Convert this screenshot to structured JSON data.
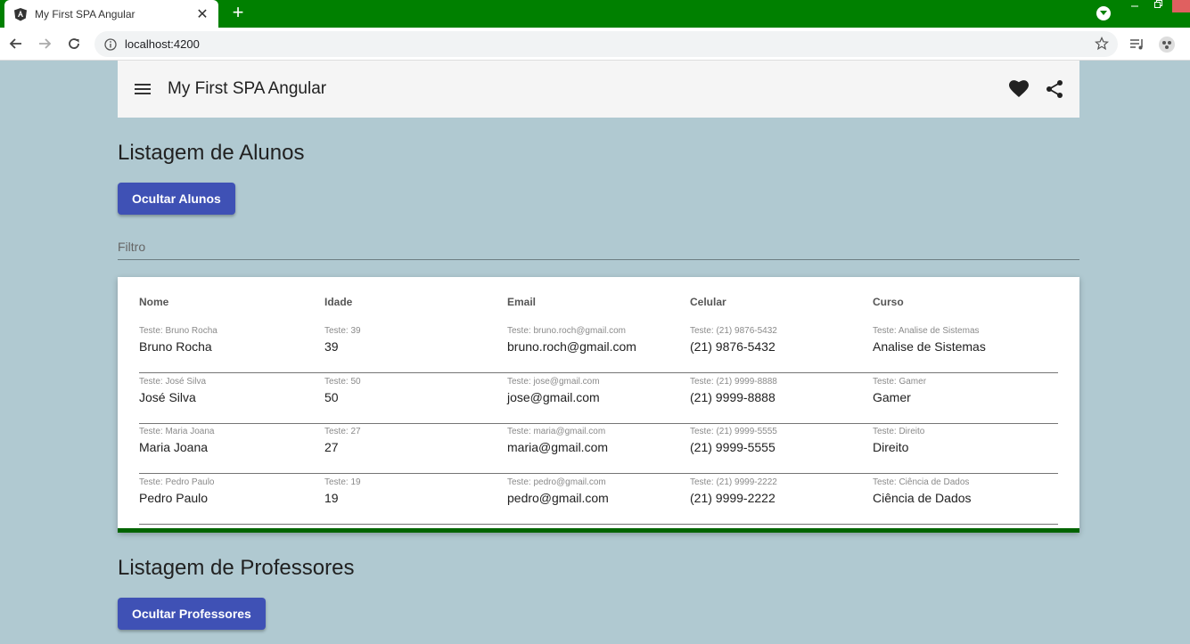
{
  "browser": {
    "tab_title": "My First SPA Angular",
    "tab_close": "✕",
    "new_tab": "+",
    "url": "localhost:4200"
  },
  "app": {
    "title": "My First SPA Angular",
    "icons": [
      "menu-icon",
      "heart-icon",
      "share-icon"
    ]
  },
  "alunos": {
    "title": "Listagem de Alunos",
    "button": "Ocultar Alunos",
    "filter_label": "Filtro",
    "headers": [
      "Nome",
      "Idade",
      "Email",
      "Celular",
      "Curso"
    ],
    "rows": [
      {
        "hints": [
          "Teste: Bruno Rocha",
          "Teste: 39",
          "Teste: bruno.roch@gmail.com",
          "Teste: (21) 9876-5432",
          "Teste: Analise de Sistemas"
        ],
        "values": [
          "Bruno Rocha",
          "39",
          "bruno.roch@gmail.com",
          "(21) 9876-5432",
          "Analise de Sistemas"
        ]
      },
      {
        "hints": [
          "Teste: José Silva",
          "Teste: 50",
          "Teste: jose@gmail.com",
          "Teste: (21) 9999-8888",
          "Teste: Gamer"
        ],
        "values": [
          "José Silva",
          "50",
          "jose@gmail.com",
          "(21) 9999-8888",
          "Gamer"
        ]
      },
      {
        "hints": [
          "Teste: Maria Joana",
          "Teste: 27",
          "Teste: maria@gmail.com",
          "Teste: (21) 9999-5555",
          "Teste: Direito"
        ],
        "values": [
          "Maria Joana",
          "27",
          "maria@gmail.com",
          "(21) 9999-5555",
          "Direito"
        ]
      },
      {
        "hints": [
          "Teste: Pedro Paulo",
          "Teste: 19",
          "Teste: pedro@gmail.com",
          "Teste: (21) 9999-2222",
          "Teste: Ciência de Dados"
        ],
        "values": [
          "Pedro Paulo",
          "19",
          "pedro@gmail.com",
          "(21) 9999-2222",
          "Ciência de Dados"
        ]
      }
    ]
  },
  "professores": {
    "title": "Listagem de Professores",
    "button": "Ocultar Professores"
  },
  "colors": {
    "tabbar": "#008000",
    "page_bg": "#b0c9d1",
    "primary": "#3f51b5",
    "card_accent": "#006400"
  }
}
